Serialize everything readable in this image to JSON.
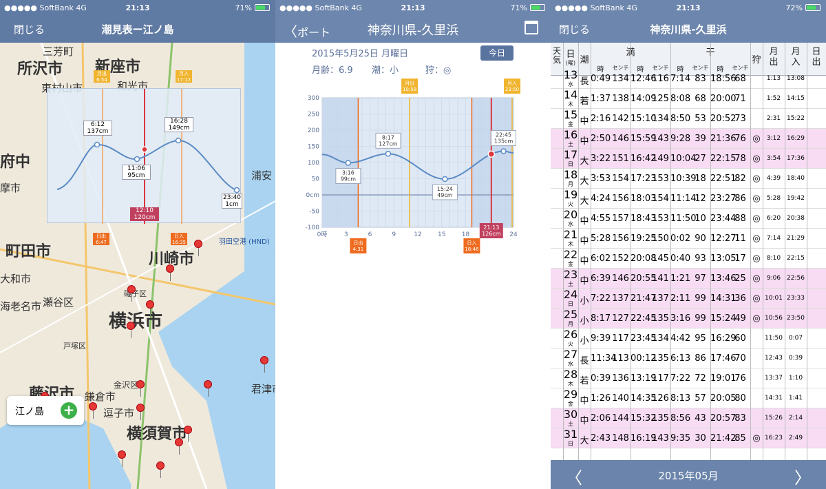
{
  "status": {
    "p1": {
      "carrier": "●●●●● SoftBank  4G",
      "time": "21:13",
      "battery": "71%"
    },
    "p2": {
      "carrier": "●●●●● SoftBank  4G",
      "time": "21:13",
      "battery": "71%"
    },
    "p3": {
      "carrier": "●●●●● SoftBank  4G",
      "time": "21:13",
      "battery": "72%"
    }
  },
  "panel1": {
    "close": "閉じる",
    "title": "潮見表ー江ノ島",
    "callout": "江ノ島",
    "callout_add": "+",
    "labels": [
      "三芳町",
      "所沢市",
      "新座市",
      "東村山市",
      "和光市",
      "府中",
      "摩市",
      "町田市",
      "大和市",
      "海老名市",
      "瀬谷区",
      "川崎市",
      "横浜市",
      "藤沢市",
      "鎌倉市",
      "逗子市",
      "横須賀市",
      "金沢区",
      "君津市",
      "浦安",
      "港北区",
      "幸区",
      "羽田空港 (HND)",
      "神奈川",
      "磯子区",
      "戸塚区"
    ],
    "chart_points": [
      {
        "t": "6:12",
        "h": "137cm"
      },
      {
        "t": "11:06",
        "h": "95cm"
      },
      {
        "t": "16:28",
        "h": "149cm"
      },
      {
        "t": "23:40",
        "h": "1cm"
      }
    ],
    "now_label": "12:10",
    "now_value": "120cm",
    "tags": {
      "sunrise": "日出",
      "sunrise_t": "4:31",
      "moonrise": "月出",
      "moonrise_t": "6:54",
      "moonset": "月入",
      "moonset_t": "17:12",
      "sunset": "日入",
      "sunset_t": "16:35",
      "moon2": "日出",
      "moon2_t": "6:47"
    }
  },
  "panel2": {
    "back": "ポート",
    "title": "神奈川県-久里浜",
    "date": "2015年5月25日 月曜日",
    "today": "今日",
    "age": "月齢：6.9",
    "tide": "潮：小",
    "hunt": "狩：◎"
  },
  "chart_data": {
    "type": "line",
    "title": "",
    "xlabel": "",
    "ylabel": "",
    "x_ticks": [
      "0時",
      "3",
      "6",
      "9",
      "12",
      "15",
      "18",
      "21",
      "24"
    ],
    "y_ticks": [
      "300",
      "250",
      "200",
      "150",
      "100",
      "50",
      "0cm",
      "-50",
      "-100"
    ],
    "ylim": [
      -100,
      300
    ],
    "xlim": [
      0,
      24
    ],
    "series": [
      {
        "x": [
          0,
          3.27,
          8.28,
          15.4,
          22.75,
          24
        ],
        "values": [
          125,
          99,
          127,
          49,
          135,
          130
        ]
      }
    ],
    "annotations": [
      {
        "x": 3.27,
        "text": "3:16",
        "value": "99cm"
      },
      {
        "x": 8.28,
        "text": "8:17",
        "value": "127cm"
      },
      {
        "x": 15.4,
        "text": "15:24",
        "value": "49cm"
      },
      {
        "x": 22.75,
        "text": "22:45",
        "value": "135cm"
      }
    ],
    "now": {
      "x": 21.22,
      "text": "21:13",
      "value": "126cm"
    },
    "markers": [
      {
        "x": 4.52,
        "label": "日出",
        "time": "4:31",
        "pos": "bottom"
      },
      {
        "x": 10.97,
        "label": "月出",
        "time": "10:58",
        "pos": "top"
      },
      {
        "x": 18.77,
        "label": "日入",
        "time": "18:46",
        "pos": "bottom"
      },
      {
        "x": 23.83,
        "label": "月入",
        "time": "23:50",
        "pos": "top"
      }
    ]
  },
  "panel3": {
    "close": "閉じる",
    "title": "神奈川県-久里浜",
    "hdr": {
      "weather": "天\n気",
      "day": "日",
      "daysub": "(曜)",
      "tide": "潮",
      "high": "満",
      "low": "干",
      "hunt": "狩",
      "moonrise": "月\n出",
      "moonset": "月\n入",
      "sunrise": "日\n出",
      "time": "時",
      "cm": "センチ"
    },
    "rows": [
      {
        "d": "13",
        "w": "水",
        "t": "長",
        "h1": "0:49",
        "h1c": "134",
        "h2": "12:46",
        "h2c": "116",
        "l1": "7:14",
        "l1c": "83",
        "l2": "18:56",
        "l2c": "68",
        "k": "",
        "mr": "1:13",
        "ms": "13:08",
        "hl": false
      },
      {
        "d": "14",
        "w": "木",
        "t": "若",
        "h1": "1:37",
        "h1c": "138",
        "h2": "14:09",
        "h2c": "125",
        "l1": "8:08",
        "l1c": "68",
        "l2": "20:00",
        "l2c": "71",
        "k": "",
        "mr": "1:52",
        "ms": "14:15",
        "hl": false
      },
      {
        "d": "15",
        "w": "金",
        "t": "中",
        "h1": "2:16",
        "h1c": "142",
        "h2": "15:10",
        "h2c": "134",
        "l1": "8:50",
        "l1c": "53",
        "l2": "20:52",
        "l2c": "73",
        "k": "",
        "mr": "2:31",
        "ms": "15:22",
        "hl": false
      },
      {
        "d": "16",
        "w": "土",
        "t": "中",
        "h1": "2:50",
        "h1c": "146",
        "h2": "15:59",
        "h2c": "143",
        "l1": "9:28",
        "l1c": "39",
        "l2": "21:36",
        "l2c": "76",
        "k": "◎",
        "mr": "3:12",
        "ms": "16:29",
        "hl": true
      },
      {
        "d": "17",
        "w": "日",
        "t": "大",
        "h1": "3:22",
        "h1c": "151",
        "h2": "16:42",
        "h2c": "149",
        "l1": "10:04",
        "l1c": "27",
        "l2": "22:15",
        "l2c": "78",
        "k": "◎",
        "mr": "3:54",
        "ms": "17:36",
        "hl": true
      },
      {
        "d": "18",
        "w": "月",
        "t": "大",
        "h1": "3:53",
        "h1c": "154",
        "h2": "17:23",
        "h2c": "153",
        "l1": "10:39",
        "l1c": "18",
        "l2": "22:51",
        "l2c": "82",
        "k": "◎",
        "mr": "4:39",
        "ms": "18:40",
        "hl": false
      },
      {
        "d": "19",
        "w": "火",
        "t": "大",
        "h1": "4:24",
        "h1c": "156",
        "h2": "18:03",
        "h2c": "154",
        "l1": "11:14",
        "l1c": "12",
        "l2": "23:27",
        "l2c": "86",
        "k": "◎",
        "mr": "5:28",
        "ms": "19:42",
        "hl": false
      },
      {
        "d": "20",
        "w": "水",
        "t": "中",
        "h1": "4:55",
        "h1c": "157",
        "h2": "18:43",
        "h2c": "153",
        "l1": "11:50",
        "l1c": "10",
        "l2": "23:44",
        "l2c": "88",
        "k": "◎",
        "mr": "6:20",
        "ms": "20:38",
        "hl": false
      },
      {
        "d": "21",
        "w": "木",
        "t": "中",
        "h1": "5:28",
        "h1c": "156",
        "h2": "19:25",
        "h2c": "150",
        "l1": "0:02",
        "l1c": "90",
        "l2": "12:27",
        "l2c": "11",
        "k": "◎",
        "mr": "7:14",
        "ms": "21:29",
        "hl": false
      },
      {
        "d": "22",
        "w": "金",
        "t": "中",
        "h1": "6:02",
        "h1c": "152",
        "h2": "20:08",
        "h2c": "145",
        "l1": "0:40",
        "l1c": "93",
        "l2": "13:05",
        "l2c": "17",
        "k": "◎",
        "mr": "8:10",
        "ms": "22:15",
        "hl": false
      },
      {
        "d": "23",
        "w": "土",
        "t": "中",
        "h1": "6:39",
        "h1c": "146",
        "h2": "20:55",
        "h2c": "141",
        "l1": "1:21",
        "l1c": "97",
        "l2": "13:46",
        "l2c": "25",
        "k": "◎",
        "mr": "9:06",
        "ms": "22:56",
        "hl": true
      },
      {
        "d": "24",
        "w": "日",
        "t": "小",
        "h1": "7:22",
        "h1c": "137",
        "h2": "21:47",
        "h2c": "137",
        "l1": "2:11",
        "l1c": "99",
        "l2": "14:31",
        "l2c": "36",
        "k": "◎",
        "mr": "10:01",
        "ms": "23:33",
        "hl": true
      },
      {
        "d": "25",
        "w": "月",
        "t": "小",
        "h1": "8:17",
        "h1c": "127",
        "h2": "22:45",
        "h2c": "135",
        "l1": "3:16",
        "l1c": "99",
        "l2": "15:24",
        "l2c": "49",
        "k": "◎",
        "mr": "10:56",
        "ms": "23:50",
        "hl": true
      },
      {
        "d": "26",
        "w": "火",
        "t": "小",
        "h1": "9:39",
        "h1c": "117",
        "h2": "23:45",
        "h2c": "134",
        "l1": "4:42",
        "l1c": "95",
        "l2": "16:29",
        "l2c": "60",
        "k": "",
        "mr": "11:50",
        "ms": "0:07",
        "hl": false
      },
      {
        "d": "27",
        "w": "水",
        "t": "長",
        "h1": "11:34",
        "h1c": "113",
        "h2": "00:12",
        "h2c": "135",
        "l1": "6:13",
        "l1c": "86",
        "l2": "17:46",
        "l2c": "70",
        "k": "",
        "mr": "12:43",
        "ms": "0:39",
        "hl": false
      },
      {
        "d": "28",
        "w": "木",
        "t": "若",
        "h1": "0:39",
        "h1c": "136",
        "h2": "13:19",
        "h2c": "117",
        "l1": "7:22",
        "l1c": "72",
        "l2": "19:01",
        "l2c": "76",
        "k": "",
        "mr": "13:37",
        "ms": "1:10",
        "hl": false
      },
      {
        "d": "29",
        "w": "金",
        "t": "中",
        "h1": "1:26",
        "h1c": "140",
        "h2": "14:35",
        "h2c": "126",
        "l1": "8:13",
        "l1c": "57",
        "l2": "20:05",
        "l2c": "80",
        "k": "",
        "mr": "14:31",
        "ms": "1:41",
        "hl": false
      },
      {
        "d": "30",
        "w": "土",
        "t": "中",
        "h1": "2:06",
        "h1c": "144",
        "h2": "15:32",
        "h2c": "135",
        "l1": "8:56",
        "l1c": "43",
        "l2": "20:57",
        "l2c": "83",
        "k": "",
        "mr": "15:26",
        "ms": "2:14",
        "hl": true
      },
      {
        "d": "31",
        "w": "日",
        "t": "大",
        "h1": "2:43",
        "h1c": "148",
        "h2": "16:19",
        "h2c": "143",
        "l1": "9:35",
        "l1c": "30",
        "l2": "21:42",
        "l2c": "85",
        "k": "◎",
        "mr": "16:23",
        "ms": "2:49",
        "hl": true
      }
    ],
    "footer_month": "2015年05月",
    "prev": "〈",
    "next": "〉"
  }
}
